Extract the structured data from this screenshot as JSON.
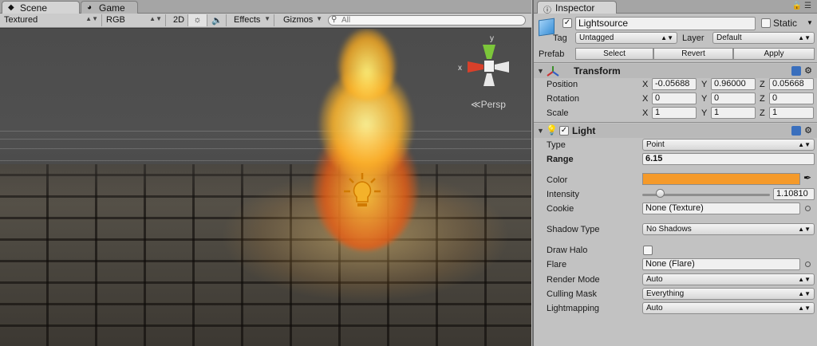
{
  "scene_panel": {
    "tabs": [
      {
        "label": "Scene",
        "icon": "scene-icon"
      },
      {
        "label": "Game",
        "icon": "pacman-icon"
      }
    ],
    "toolbar": {
      "shading_mode": "Textured",
      "render_mode": "RGB",
      "mode_2d": "2D",
      "effects": "Effects",
      "gizmos": "Gizmos",
      "search_placeholder": "All"
    },
    "gizmo": {
      "y_axis": "y",
      "x_axis": "x",
      "projection": "Persp"
    }
  },
  "inspector": {
    "tab_label": "Inspector",
    "object": {
      "name": "Lightsource",
      "active": true,
      "static_label": "Static",
      "static_checked": false,
      "tag_label": "Tag",
      "tag_value": "Untagged",
      "layer_label": "Layer",
      "layer_value": "Default",
      "prefab_label": "Prefab",
      "prefab_buttons": [
        "Select",
        "Revert",
        "Apply"
      ]
    },
    "transform": {
      "title": "Transform",
      "position": {
        "label": "Position",
        "x": "-0.05688",
        "y": "0.96000",
        "z": "0.05668"
      },
      "rotation": {
        "label": "Rotation",
        "x": "0",
        "y": "0",
        "z": "0"
      },
      "scale": {
        "label": "Scale",
        "x": "1",
        "y": "1",
        "z": "1"
      },
      "axis_x": "X",
      "axis_y": "Y",
      "axis_z": "Z"
    },
    "light": {
      "title": "Light",
      "enabled": true,
      "type_label": "Type",
      "type_value": "Point",
      "range_label": "Range",
      "range_value": "6.15",
      "color_label": "Color",
      "color_value": "#f59a2a",
      "intensity_label": "Intensity",
      "intensity_value": "1.10810",
      "intensity_fraction": 0.14,
      "cookie_label": "Cookie",
      "cookie_value": "None (Texture)",
      "shadow_label": "Shadow Type",
      "shadow_value": "No Shadows",
      "halo_label": "Draw Halo",
      "halo_checked": false,
      "flare_label": "Flare",
      "flare_value": "None (Flare)",
      "render_mode_label": "Render Mode",
      "render_mode_value": "Auto",
      "culling_label": "Culling Mask",
      "culling_value": "Everything",
      "lightmapping_label": "Lightmapping",
      "lightmapping_value": "Auto"
    }
  }
}
